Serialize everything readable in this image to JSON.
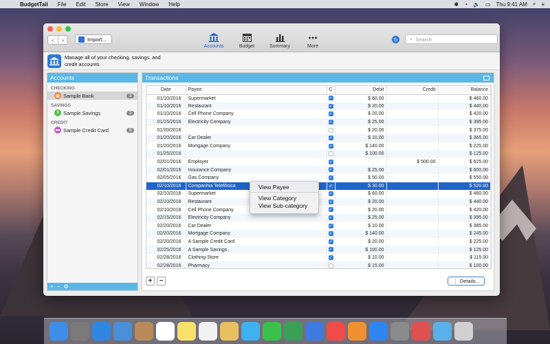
{
  "menubar": {
    "app_name": "BudgetTail",
    "items": [
      "File",
      "Edit",
      "Store",
      "View",
      "Window",
      "Help"
    ],
    "clock": "Thu 9:41 AM"
  },
  "toolbar": {
    "import_label": "Import...",
    "tools": [
      {
        "label": "Accounts",
        "icon": "bank-icon",
        "active": true
      },
      {
        "label": "Budget",
        "icon": "calendar-icon",
        "active": false
      },
      {
        "label": "Summary",
        "icon": "bar-chart-icon",
        "active": false
      },
      {
        "label": "More",
        "icon": "more-dots-icon",
        "active": false
      }
    ],
    "search_placeholder": "Search"
  },
  "banner": {
    "text": "Manage all of your checking, savings, and credit accounts"
  },
  "sidebar": {
    "title": "Accounts",
    "groups": [
      {
        "name": "CHECKING",
        "accounts": [
          {
            "name": "Sample Bank",
            "count": "3",
            "color": "#f0883a",
            "selected": true
          }
        ]
      },
      {
        "name": "SAVINGS",
        "accounts": [
          {
            "name": "Sample Savings",
            "count": "2",
            "color": "#4cbf4c",
            "selected": false
          }
        ]
      },
      {
        "name": "CREDIT",
        "accounts": [
          {
            "name": "Sample Credit Card",
            "count": "9",
            "color": "#c45bc4",
            "selected": false
          }
        ]
      }
    ]
  },
  "transactions": {
    "title": "Transactions",
    "columns": [
      "Date",
      "Payee",
      "C",
      "Debit",
      "Credit",
      "Balance"
    ],
    "rows": [
      {
        "date": "01/10/2016",
        "payee": "Supermarket",
        "c": true,
        "debit": "$ 60.00",
        "credit": "",
        "balance": "$ 460.00"
      },
      {
        "date": "01/10/2016",
        "payee": "Restaurant",
        "c": true,
        "debit": "$ 20.00",
        "credit": "",
        "balance": "$ 440.00"
      },
      {
        "date": "01/10/2016",
        "payee": "Cell Phone Company",
        "c": true,
        "debit": "$ 20.00",
        "credit": "",
        "balance": "$ 420.00"
      },
      {
        "date": "01/15/2016",
        "payee": "Electricity Company",
        "c": true,
        "debit": "$ 25.00",
        "credit": "",
        "balance": "$ 395.00"
      },
      {
        "date": "01/20/2016",
        "payee": "",
        "c": false,
        "debit": "$ 20.00",
        "credit": "",
        "balance": "$ 375.00"
      },
      {
        "date": "01/20/2016",
        "payee": "Car Dealer",
        "c": true,
        "debit": "$ 10.00",
        "credit": "",
        "balance": "$ 365.00"
      },
      {
        "date": "01/20/2016",
        "payee": "Mortgage Company",
        "c": true,
        "debit": "$ 140.00",
        "credit": "",
        "balance": "$ 225.00"
      },
      {
        "date": "01/25/2016",
        "payee": "",
        "c": false,
        "debit": "$ 100.00",
        "credit": "",
        "balance": "$ 125.00"
      },
      {
        "date": "02/01/2016",
        "payee": "Employer",
        "c": true,
        "debit": "",
        "credit": "$ 500.00",
        "balance": "$ 625.00"
      },
      {
        "date": "02/01/2016",
        "payee": "Insurance Company",
        "c": true,
        "debit": "$ 25.00",
        "credit": "",
        "balance": "$ 600.00"
      },
      {
        "date": "02/05/2016",
        "payee": "Gas Company",
        "c": true,
        "debit": "$ 50.00",
        "credit": "",
        "balance": "$ 550.00"
      },
      {
        "date": "02/10/2016",
        "payee": "Companhia Telefônica",
        "c": true,
        "debit": "$ 30.00",
        "credit": "",
        "balance": "$ 520.00",
        "selected": true
      },
      {
        "date": "02/10/2016",
        "payee": "Supermarket",
        "c": true,
        "debit": "$ 60.00",
        "credit": "",
        "balance": "$ 460.00"
      },
      {
        "date": "02/10/2016",
        "payee": "Restaurant",
        "c": true,
        "debit": "$ 20.00",
        "credit": "",
        "balance": "$ 440.00"
      },
      {
        "date": "02/10/2016",
        "payee": "Cell Phone Company",
        "c": true,
        "debit": "$ 20.00",
        "credit": "",
        "balance": "$ 420.00"
      },
      {
        "date": "02/15/2016",
        "payee": "Electricity Company",
        "c": true,
        "debit": "$ 25.00",
        "credit": "",
        "balance": "$ 395.00"
      },
      {
        "date": "02/20/2016",
        "payee": "Car Dealer",
        "c": true,
        "debit": "$ 10.00",
        "credit": "",
        "balance": "$ 385.00"
      },
      {
        "date": "02/20/2016",
        "payee": "Mortgage Company",
        "c": true,
        "debit": "$ 140.00",
        "credit": "",
        "balance": "$ 245.00"
      },
      {
        "date": "02/20/2016",
        "payee": "A Sample Credit Card",
        "c": true,
        "debit": "$ 20.00",
        "credit": "",
        "balance": "$ 225.00"
      },
      {
        "date": "02/25/2016",
        "payee": "A Sample Savings",
        "c": true,
        "debit": "$ 100.00",
        "credit": "",
        "balance": "$ 125.00"
      },
      {
        "date": "02/28/2016",
        "payee": "Clothing Store",
        "c": true,
        "debit": "$ 10.00",
        "credit": "",
        "balance": "$ 115.00"
      },
      {
        "date": "02/28/2016",
        "payee": "Pharmacy",
        "c": false,
        "debit": "$ 15.00",
        "credit": "",
        "balance": "$ 100.00"
      }
    ],
    "details_label": "Details..."
  },
  "context_menu": {
    "items": [
      "View Payee",
      "View Category",
      "View Sub-category"
    ]
  },
  "dock": {
    "icons": [
      "finder-icon",
      "launchpad-icon",
      "safari-icon",
      "mail-icon",
      "contacts-icon",
      "calendar-icon",
      "notes-icon",
      "reminders-icon",
      "photos-icon",
      "messages-icon",
      "facetime-icon",
      "numbers-icon",
      "keynote-icon",
      "music-icon",
      "books-icon",
      "appstore-icon",
      "system-preferences-icon",
      "budgettail-icon",
      "downloads-icon",
      "trash-icon"
    ],
    "colors": [
      "#3c8ee8",
      "#7a7a7a",
      "#2f86e0",
      "#4a8fd8",
      "#b88a5a",
      "#ffffff",
      "#f7e16a",
      "#f2f2f2",
      "#e8c060",
      "#3fb0f0",
      "#3cc04c",
      "#3aa055",
      "#3f7ae0",
      "#f04a4a",
      "#f09030",
      "#2f86f0",
      "#8a8a8a",
      "#e05050",
      "#5ab0e8",
      "#d0d0d0"
    ]
  }
}
